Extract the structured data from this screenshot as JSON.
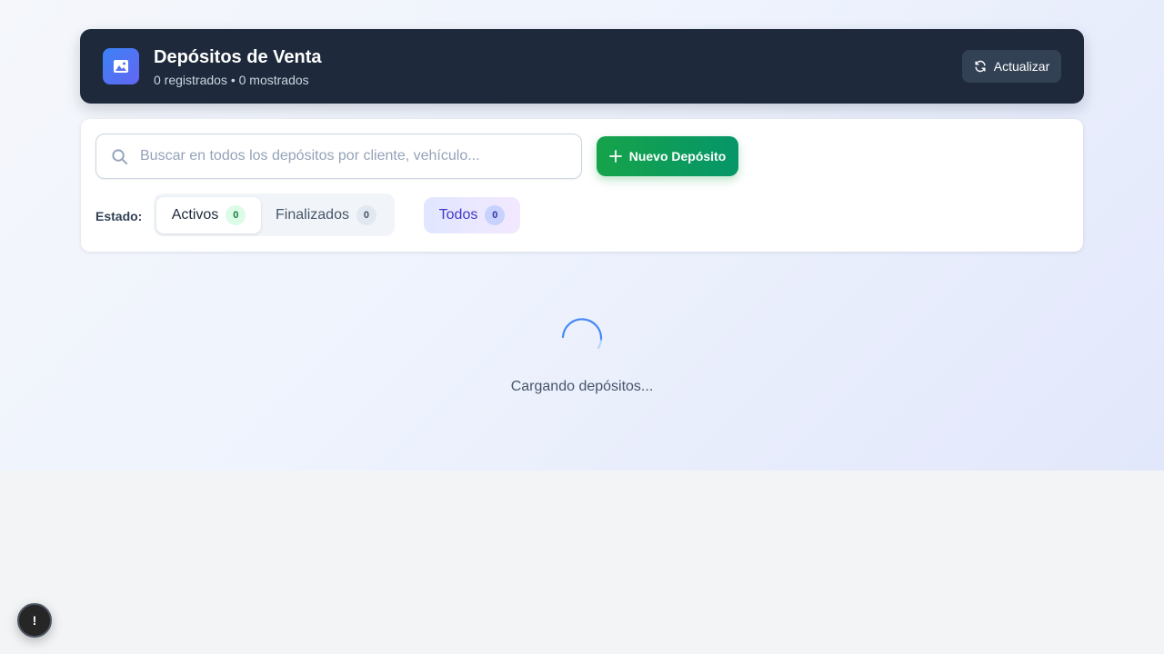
{
  "header": {
    "title": "Depósitos de Venta",
    "subtitle": "0 registrados • 0 mostrados",
    "refresh_label": "Actualizar",
    "logo_icon": "image-icon",
    "refresh_icon": "refresh-icon"
  },
  "search": {
    "value": "",
    "placeholder": "Buscar en todos los depósitos por cliente, vehículo...",
    "icon": "search-icon"
  },
  "new_button": {
    "label": "Nuevo Depósito",
    "icon": "plus-icon"
  },
  "filters": {
    "estado_label": "Estado:",
    "tabs": [
      {
        "label": "Activos",
        "count": "0",
        "selected": true
      },
      {
        "label": "Finalizados",
        "count": "0",
        "selected": false
      }
    ],
    "todos": {
      "label": "Todos",
      "count": "0"
    }
  },
  "loading": {
    "text": "Cargando depósitos..."
  },
  "fab": {
    "label": "!"
  },
  "colors": {
    "header_bg": "#1e293b",
    "accent_green": "#16a34a",
    "accent_indigo": "#4338ca",
    "spinner": "#3b82f6"
  }
}
